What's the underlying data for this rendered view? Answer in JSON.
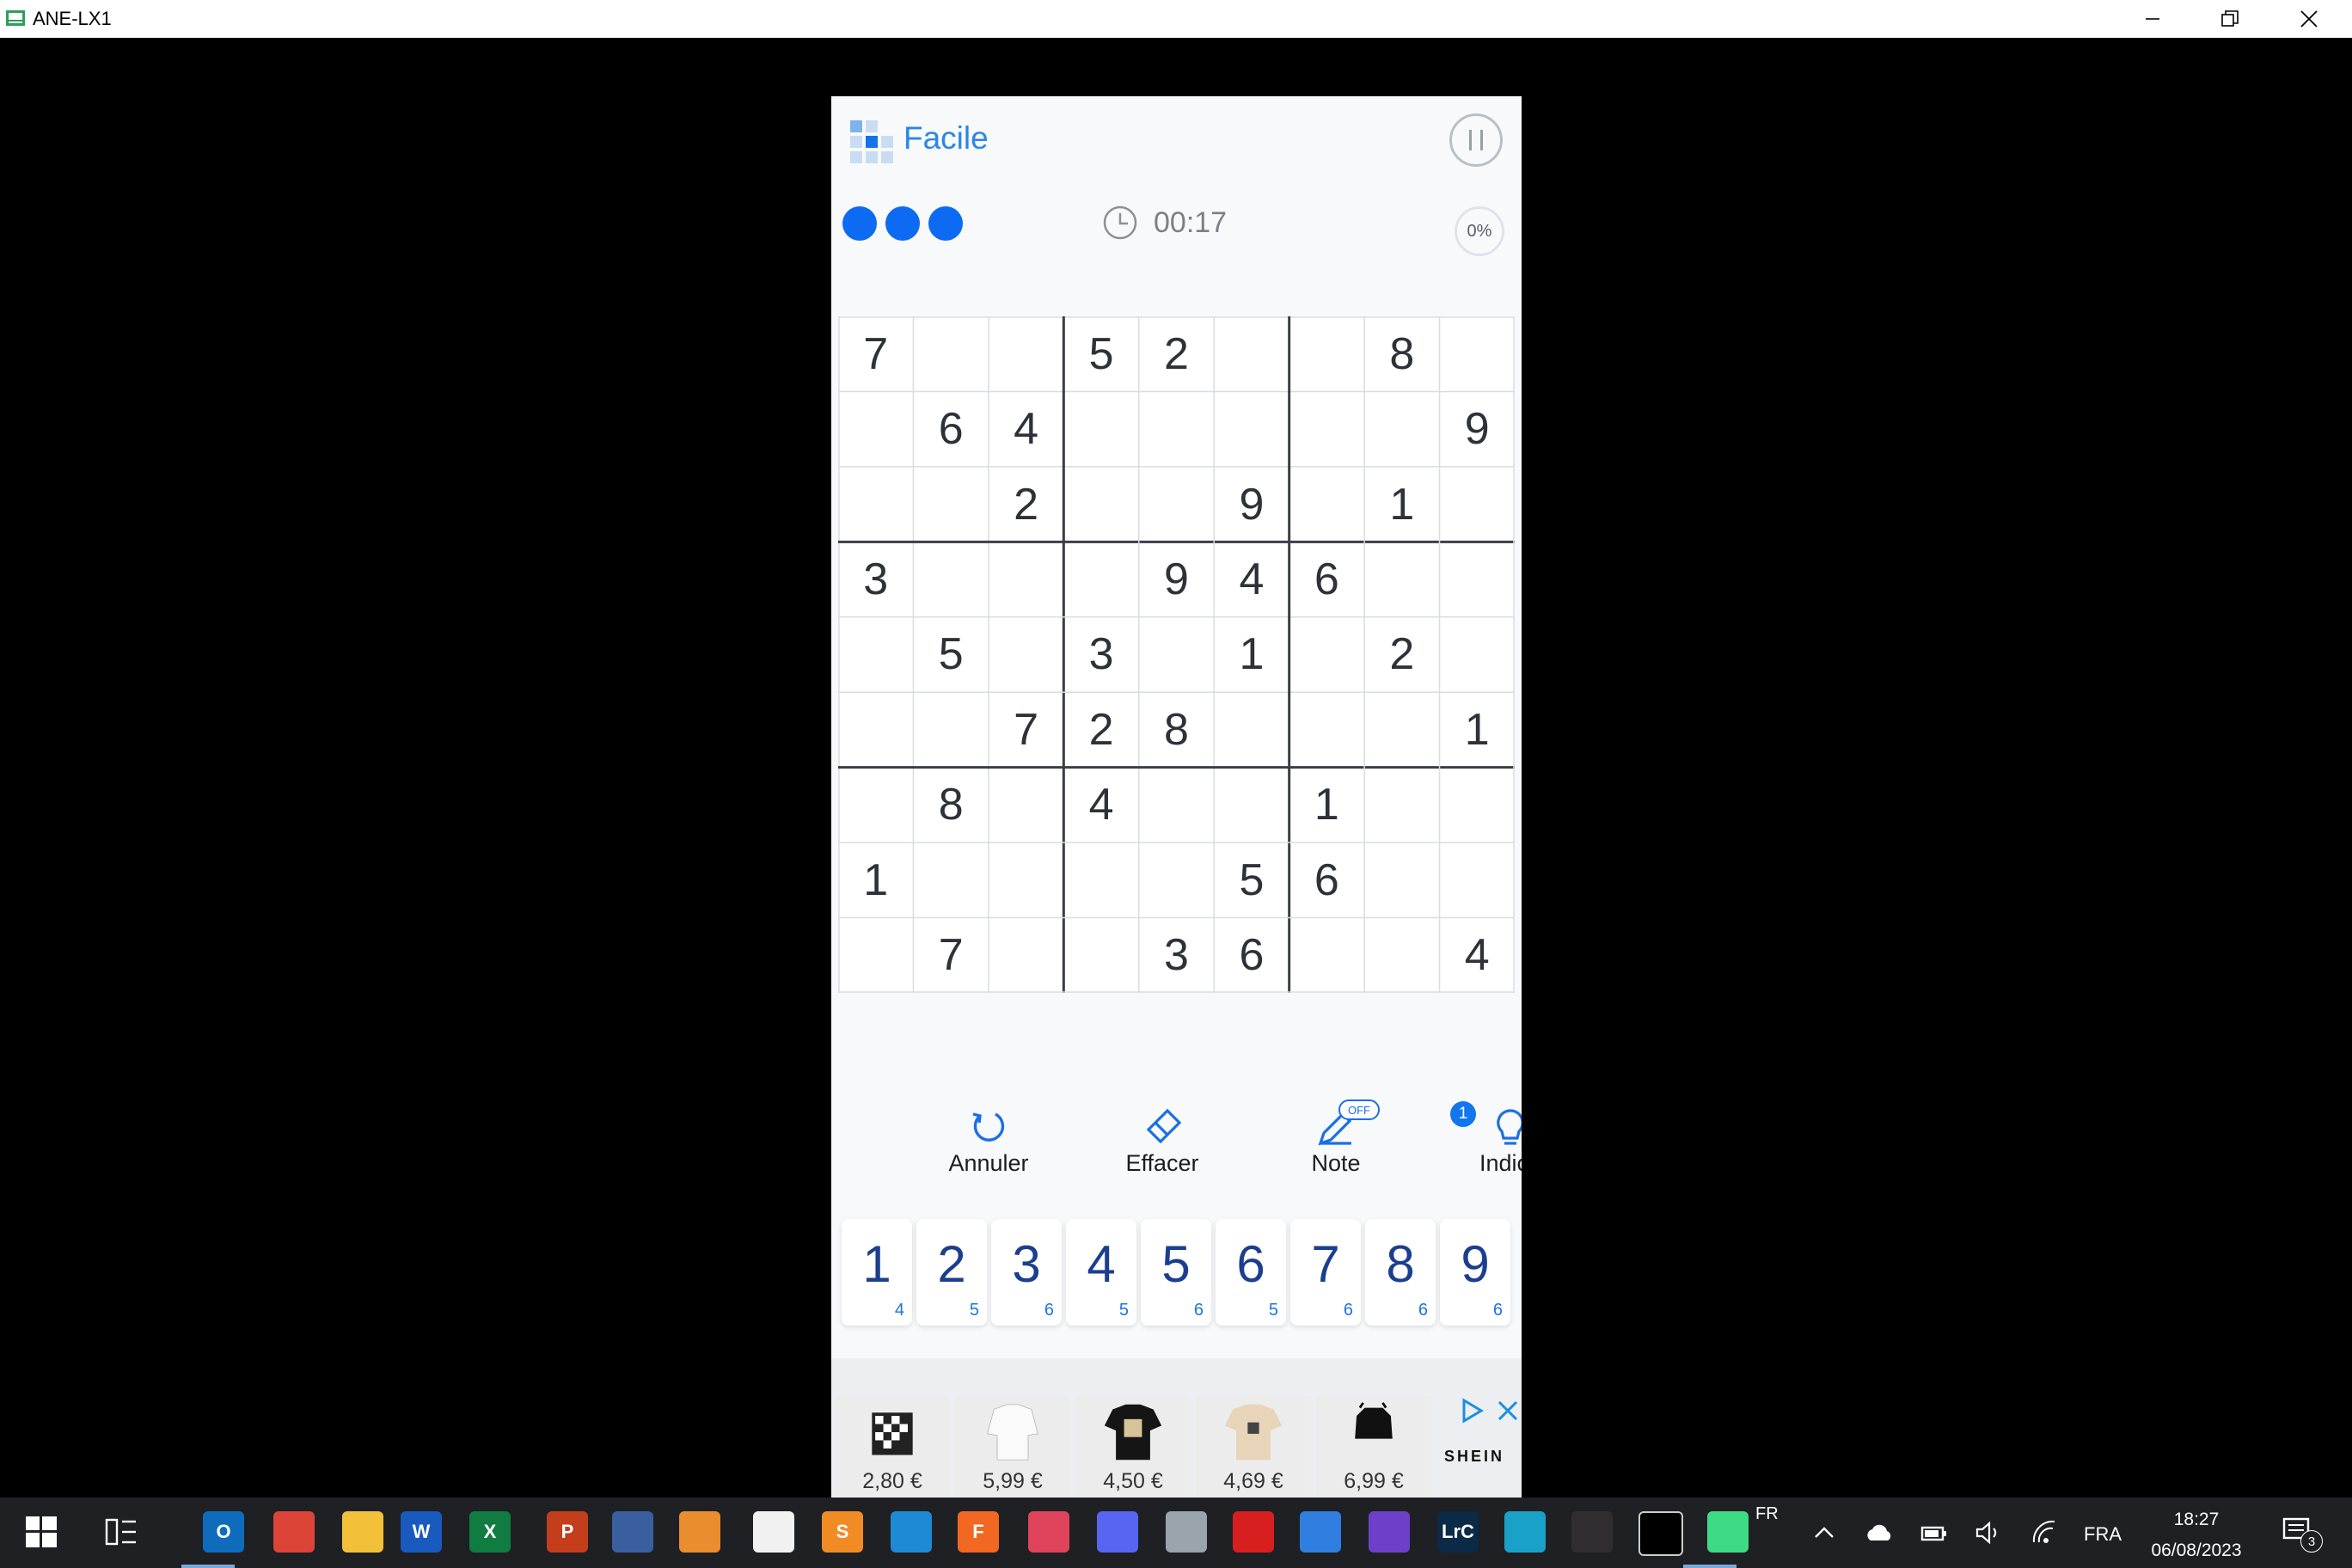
{
  "window": {
    "title": "ANE-LX1"
  },
  "game": {
    "difficulty": "Facile",
    "timer": "00:17",
    "progress": "0%",
    "mistakes_remaining": 3,
    "accent_color": "#0c6bf2",
    "grid": [
      [
        7,
        0,
        0,
        5,
        2,
        0,
        0,
        8,
        0
      ],
      [
        0,
        6,
        4,
        0,
        0,
        0,
        0,
        0,
        9
      ],
      [
        0,
        0,
        2,
        0,
        0,
        9,
        0,
        1,
        0
      ],
      [
        3,
        0,
        0,
        0,
        9,
        4,
        6,
        0,
        0
      ],
      [
        0,
        5,
        0,
        3,
        0,
        1,
        0,
        2,
        0
      ],
      [
        0,
        0,
        7,
        2,
        8,
        0,
        0,
        0,
        1
      ],
      [
        0,
        8,
        0,
        4,
        0,
        0,
        1,
        0,
        0
      ],
      [
        1,
        0,
        0,
        0,
        0,
        5,
        6,
        0,
        0
      ],
      [
        0,
        7,
        0,
        0,
        3,
        6,
        0,
        0,
        4
      ]
    ]
  },
  "tools": {
    "undo": "Annuler",
    "erase": "Effacer",
    "note": "Note",
    "note_state": "OFF",
    "hint": "Indice",
    "hint_count": "1"
  },
  "numpad": [
    {
      "digit": "1",
      "count": "4"
    },
    {
      "digit": "2",
      "count": "5"
    },
    {
      "digit": "3",
      "count": "6"
    },
    {
      "digit": "4",
      "count": "5"
    },
    {
      "digit": "5",
      "count": "6"
    },
    {
      "digit": "6",
      "count": "5"
    },
    {
      "digit": "7",
      "count": "6"
    },
    {
      "digit": "8",
      "count": "6"
    },
    {
      "digit": "9",
      "count": "6"
    }
  ],
  "ad": {
    "brand": "SHEIN",
    "items": [
      {
        "price": "2,80 €",
        "icon": "checkered-top"
      },
      {
        "price": "5,99 €",
        "icon": "white-shirt"
      },
      {
        "price": "4,50 €",
        "icon": "black-tshirt"
      },
      {
        "price": "4,69 €",
        "icon": "beige-tshirt"
      },
      {
        "price": "6,99 €",
        "icon": "black-crop-top"
      }
    ]
  },
  "taskbar": {
    "apps": [
      {
        "name": "outlook",
        "label": "O",
        "color": "#0f6cbd"
      },
      {
        "name": "chrome",
        "label": "",
        "color": "#db4437"
      },
      {
        "name": "file-explorer",
        "label": "",
        "color": "#f3c03a"
      },
      {
        "name": "word",
        "label": "W",
        "color": "#185abd"
      },
      {
        "name": "excel",
        "label": "X",
        "color": "#107c41"
      },
      {
        "name": "powerpoint",
        "label": "P",
        "color": "#c43e1c"
      },
      {
        "name": "editor",
        "label": "",
        "color": "#3a5f9e"
      },
      {
        "name": "media-player",
        "label": "",
        "color": "#e98d2f"
      },
      {
        "name": "python-file",
        "label": "",
        "color": "#f1f1f1"
      },
      {
        "name": "sublime",
        "label": "S",
        "color": "#f18c25"
      },
      {
        "name": "vscode",
        "label": "",
        "color": "#1e8ad6"
      },
      {
        "name": "fusion360",
        "label": "F",
        "color": "#f26722"
      },
      {
        "name": "scissors-tool",
        "label": "",
        "color": "#e0445c"
      },
      {
        "name": "discord",
        "label": "",
        "color": "#5865f2"
      },
      {
        "name": "agent-app",
        "label": "",
        "color": "#9aa4ad"
      },
      {
        "name": "acrobat",
        "label": "",
        "color": "#d71f1f"
      },
      {
        "name": "app-store",
        "label": "",
        "color": "#2f7ee0"
      },
      {
        "name": "github",
        "label": "",
        "color": "#6e40c9"
      },
      {
        "name": "lightroom",
        "label": "LrC",
        "color": "#0a2a47"
      },
      {
        "name": "split-app",
        "label": "",
        "color": "#1aa1c7"
      },
      {
        "name": "obs",
        "label": "",
        "color": "#302e31"
      },
      {
        "name": "terminal",
        "label": "",
        "color": "#000000"
      },
      {
        "name": "android-emulator",
        "label": "",
        "color": "#3ddc84"
      }
    ],
    "keyboard_small": "FR",
    "language": "FRA",
    "time": "18:27",
    "date": "06/08/2023",
    "notifications": "3"
  }
}
